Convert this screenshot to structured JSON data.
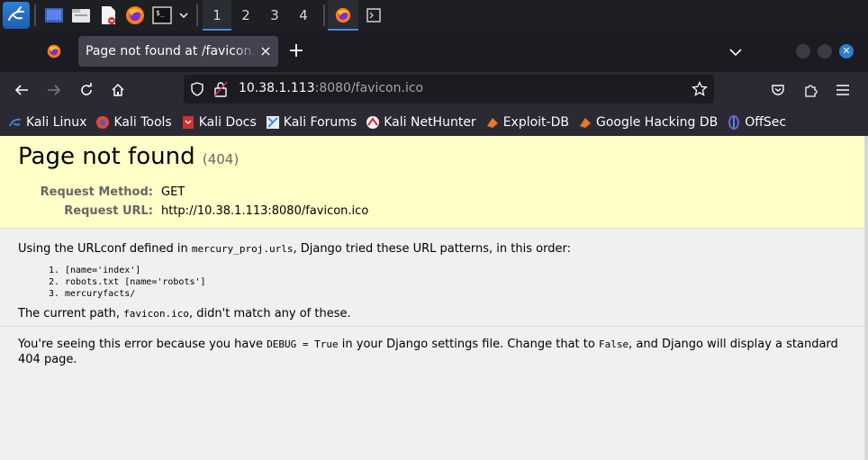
{
  "taskbar": {
    "workspaces": [
      "1",
      "2",
      "3",
      "4"
    ],
    "active_workspace": "1",
    "icons": [
      "kali-menu-icon",
      "desktop-icon",
      "file-manager-icon",
      "text-editor-icon",
      "firefox-icon",
      "terminal-icon"
    ]
  },
  "browser": {
    "tab_title": "Page not found at /favicon.ico",
    "url_host": "10.38.1.113",
    "url_rest": ":8080/favicon.ico"
  },
  "bookmarks": [
    {
      "label": "Kali Linux",
      "color": "#3d8fe4"
    },
    {
      "label": "Kali Tools",
      "color": "#e0483e"
    },
    {
      "label": "Kali Docs",
      "color": "#d32f2f"
    },
    {
      "label": "Kali Forums",
      "color": "#3d8fe4"
    },
    {
      "label": "Kali NetHunter",
      "color": "#d32f2f"
    },
    {
      "label": "Exploit-DB",
      "color": "#e8772a"
    },
    {
      "label": "Google Hacking DB",
      "color": "#e8772a"
    },
    {
      "label": "OffSec",
      "color": "#7b5cd6"
    }
  ],
  "page": {
    "heading": "Page not found",
    "status_code": "(404)",
    "request_method_label": "Request Method:",
    "request_method": "GET",
    "request_url_label": "Request URL:",
    "request_url": "http://10.38.1.113:8080/favicon.ico",
    "urlconf_prefix": "Using the URLconf defined in ",
    "urlconf_name": "mercury_proj.urls",
    "urlconf_suffix": ", Django tried these URL patterns, in this order:",
    "patterns": [
      "[name='index']",
      "robots.txt [name='robots']",
      "mercuryfacts/"
    ],
    "current_path_prefix": "The current path, ",
    "current_path": "favicon.ico",
    "current_path_suffix": ", didn't match any of these.",
    "explanation_1": "You're seeing this error because you have ",
    "debug_code": "DEBUG = True",
    "explanation_2": " in your Django settings file. Change that to ",
    "false_code": "False",
    "explanation_3": ", and Django will display a standard 404 page."
  },
  "colors": {
    "summary_bg": "#ffffc8",
    "page_bg": "#f0f0f0",
    "accent": "#3d8fe4"
  }
}
